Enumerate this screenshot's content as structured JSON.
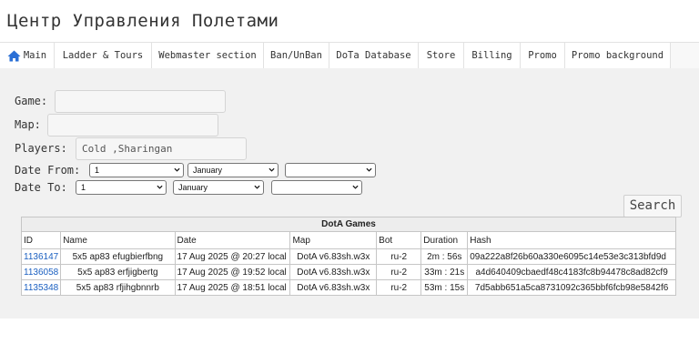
{
  "page": {
    "title": "Центр Управления Полетами"
  },
  "nav": {
    "items": [
      {
        "label": "Main",
        "icon": "home-icon"
      },
      {
        "label": "Ladder & Tours"
      },
      {
        "label": "Webmaster section"
      },
      {
        "label": "Ban/UnBan"
      },
      {
        "label": "DoTa Database"
      },
      {
        "label": "Store"
      },
      {
        "label": "Billing"
      },
      {
        "label": "Promo"
      },
      {
        "label": "Promo background"
      }
    ],
    "icon_color": "#2a6fd6"
  },
  "form": {
    "game_label": "Game:",
    "game_value": "",
    "map_label": "Map:",
    "map_value": "",
    "players_label": "Players:",
    "players_value": "Cold ,Sharingan",
    "date_from_label": "Date From:",
    "date_from_day": "1",
    "date_from_month": "January",
    "date_from_year": "",
    "date_to_label": "Date To:",
    "date_to_day": "1",
    "date_to_month": "January",
    "date_to_year": "",
    "search_label": "Search"
  },
  "table": {
    "caption": "DotA Games",
    "columns": [
      "ID",
      "Name",
      "Date",
      "Map",
      "Bot",
      "Duration",
      "Hash"
    ],
    "rows": [
      {
        "id": "1136147",
        "name": "5x5 ap83 efugbierfbng",
        "date": "17 Aug 2025 @ 20:27 local",
        "map": "DotA v6.83sh.w3x",
        "bot": "ru-2",
        "duration": "2m : 56s",
        "hash": "09a222a8f26b60a330e6095c14e53e3c313bfd9d"
      },
      {
        "id": "1136058",
        "name": "5x5 ap83 erfjigbertg",
        "date": "17 Aug 2025 @ 19:52 local",
        "map": "DotA v6.83sh.w3x",
        "bot": "ru-2",
        "duration": "33m : 21s",
        "hash": "a4d640409cbaedf48c4183fc8b94478c8ad82cf9"
      },
      {
        "id": "1135348",
        "name": "5x5 ap83 rfjihgbnnrb",
        "date": "17 Aug 2025 @ 18:51 local",
        "map": "DotA v6.83sh.w3x",
        "bot": "ru-2",
        "duration": "53m : 15s",
        "hash": "7d5abb651a5ca8731092c365bbf6fcb98e5842f6"
      }
    ],
    "link_color": "#1a5fc0"
  }
}
